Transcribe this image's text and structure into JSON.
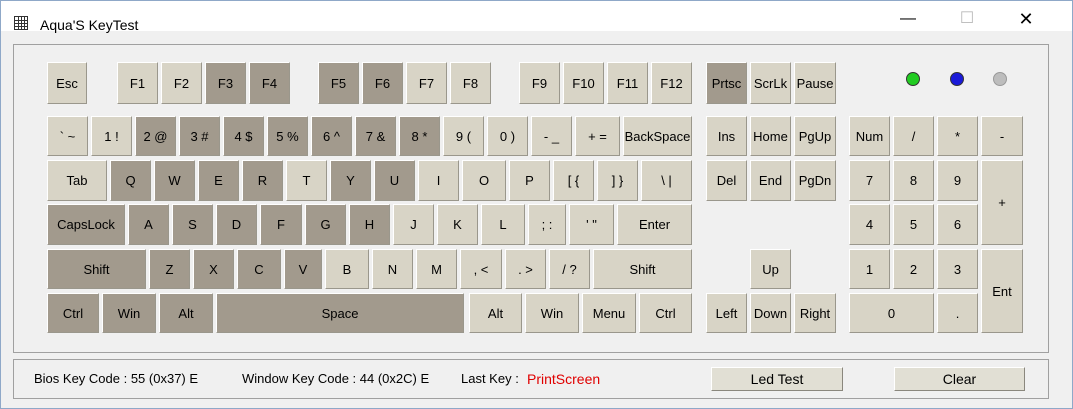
{
  "window": {
    "title": "Aqua'S KeyTest",
    "controls": {
      "minimize": "—",
      "maximize": "☐",
      "close": "✕"
    }
  },
  "keys": {
    "esc": "Esc",
    "f1": "F1",
    "f2": "F2",
    "f3": "F3",
    "f4": "F4",
    "f5": "F5",
    "f6": "F6",
    "f7": "F7",
    "f8": "F8",
    "f9": "F9",
    "f10": "F10",
    "f11": "F11",
    "f12": "F12",
    "prtsc": "Prtsc",
    "scrlk": "ScrLk",
    "pause": "Pause",
    "backtick": "` ~",
    "1": "1 !",
    "2": "2 @",
    "3": "3 #",
    "4": "4 $",
    "5": "5 %",
    "6": "6 ^",
    "7": "7 &",
    "8": "8 *",
    "9": "9 (",
    "0": "0 )",
    "minus": "- _",
    "equal": "+ =",
    "backspace": "BackSpace",
    "tab": "Tab",
    "q": "Q",
    "w": "W",
    "e": "E",
    "r": "R",
    "t": "T",
    "y": "Y",
    "u": "U",
    "i": "I",
    "o": "O",
    "p": "P",
    "lbracket": "[ {",
    "rbracket": "] }",
    "backslash": "\\ |",
    "capslock": "CapsLock",
    "a": "A",
    "s": "S",
    "d": "D",
    "f": "F",
    "g": "G",
    "h": "H",
    "j": "J",
    "k": "K",
    "l": "L",
    "semicolon": "; :",
    "quote": "' \"",
    "enter": "Enter",
    "lshift": "Shift",
    "z": "Z",
    "x": "X",
    "c": "C",
    "v": "V",
    "b": "B",
    "n": "N",
    "m": "M",
    "comma": ", <",
    "period": ". >",
    "slash": "/ ?",
    "rshift": "Shift",
    "lctrl": "Ctrl",
    "lwin": "Win",
    "lalt": "Alt",
    "space": "Space",
    "ralt": "Alt",
    "rwin": "Win",
    "menu": "Menu",
    "rctrl": "Ctrl",
    "ins": "Ins",
    "home": "Home",
    "pgup": "PgUp",
    "del": "Del",
    "end": "End",
    "pgdn": "PgDn",
    "up": "Up",
    "left": "Left",
    "down": "Down",
    "right": "Right",
    "num": "Num",
    "np_div": "/",
    "np_mul": "*",
    "np_sub": "-",
    "np7": "7",
    "np8": "8",
    "np9": "9",
    "np_add": "+",
    "np4": "4",
    "np5": "5",
    "np6": "6",
    "np1": "1",
    "np2": "2",
    "np3": "3",
    "np_ent": "Ent",
    "np0": "0",
    "np_dot": "."
  },
  "leds": [
    {
      "name": "led-green",
      "color": "#22cc22"
    },
    {
      "name": "led-blue",
      "color": "#1a1ad8"
    },
    {
      "name": "led-gray",
      "color": "#bdbdbd"
    }
  ],
  "colors": {
    "key_up": "#d8d4c6",
    "key_pressed": "#a29a8d",
    "last_key": "#e00000"
  },
  "status": {
    "bios_label": "Bios Key Code : 55 (0x37) E",
    "window_label": "Window Key Code : 44 (0x2C) E",
    "last_key_label": "Last Key :",
    "last_key_value": "PrintScreen",
    "led_test_button": "Led Test",
    "clear_button": "Clear"
  }
}
